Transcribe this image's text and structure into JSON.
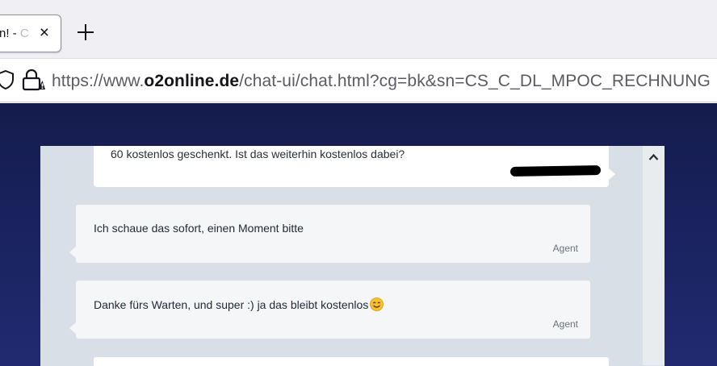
{
  "browser": {
    "tab": {
      "title_visible": "n! - ",
      "title_faded": "C",
      "close_glyph": "×"
    },
    "new_tab_icon": "plus-icon",
    "url": {
      "prefix": "https://www.",
      "host": "o2online.de",
      "path": "/chat-ui/chat.html?cg=bk&sn=CS_C_DL_MPOC_RECHNUNG"
    }
  },
  "chat": {
    "messages": [
      {
        "sender": "customer",
        "text": "60 kostenlos geschenkt. Ist das weiterhin kostenlos dabei?",
        "name_redacted": true
      },
      {
        "sender": "agent",
        "text": "Ich schaue das sofort, einen Moment bitte",
        "label": "Agent"
      },
      {
        "sender": "agent",
        "text": "Danke fürs Warten, und super :) ja das bleibt kostenlos",
        "emoji": "smiling-face-emoji",
        "label": "Agent"
      }
    ]
  },
  "colors": {
    "page_bg_top": "#141c4d",
    "page_bg_bottom": "#212a70",
    "chat_panel_bg": "#d8dfe6",
    "emoji_yellow": "#f6c22b"
  }
}
